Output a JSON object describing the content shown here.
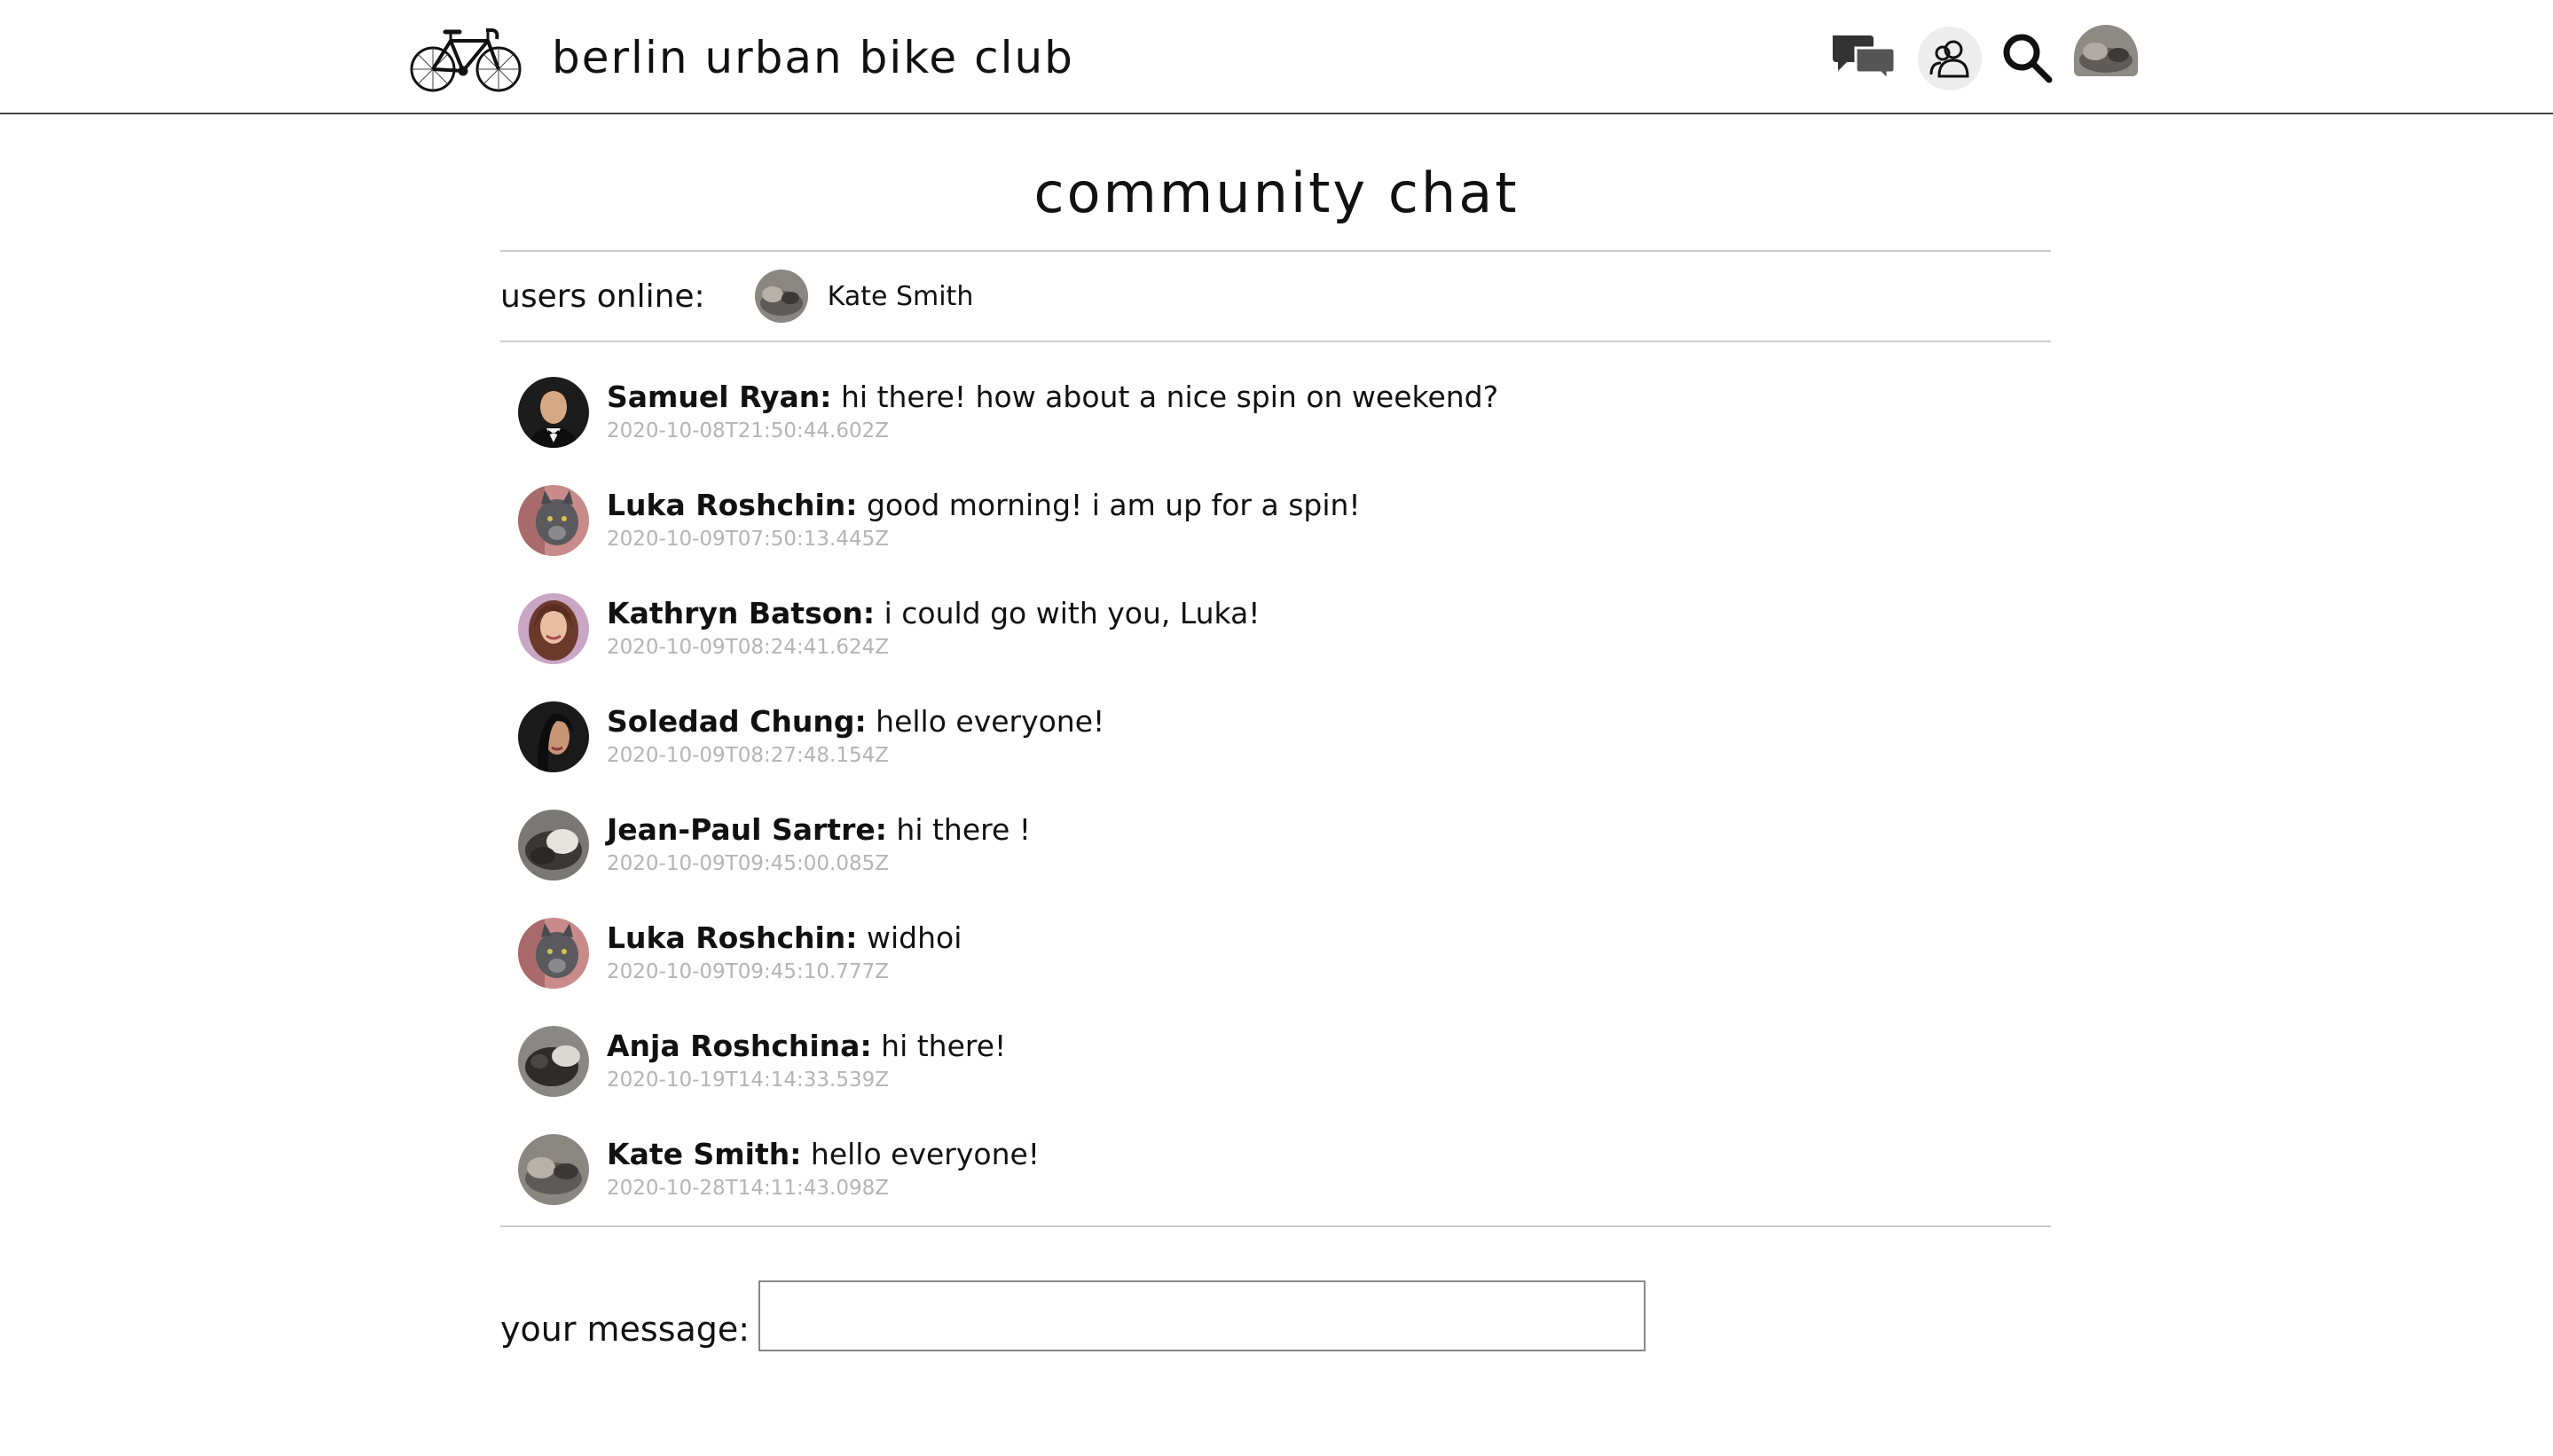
{
  "app": {
    "name": "berlin urban bike club"
  },
  "header": {
    "icons": {
      "chat": "chat-bubbles-icon",
      "friends": "friends-icon",
      "search": "search-icon",
      "profile": "profile-avatar"
    }
  },
  "page": {
    "title": "community chat"
  },
  "online": {
    "label": "users online:",
    "users": [
      {
        "name": "Kate Smith"
      }
    ]
  },
  "messages": [
    {
      "author": "Samuel Ryan:",
      "text": "hi there! how about a nice spin on weekend?",
      "time": "2020-10-08T21:50:44.602Z"
    },
    {
      "author": "Luka Roshchin:",
      "text": "good morning! i am up for a spin!",
      "time": "2020-10-09T07:50:13.445Z"
    },
    {
      "author": "Kathryn Batson:",
      "text": "i could go with you, Luka!",
      "time": "2020-10-09T08:24:41.624Z"
    },
    {
      "author": "Soledad Chung:",
      "text": "hello everyone!",
      "time": "2020-10-09T08:27:48.154Z"
    },
    {
      "author": "Jean-Paul Sartre:",
      "text": "hi there !",
      "time": "2020-10-09T09:45:00.085Z"
    },
    {
      "author": "Luka Roshchin:",
      "text": "widhoi",
      "time": "2020-10-09T09:45:10.777Z"
    },
    {
      "author": "Anja Roshchina:",
      "text": "hi there!",
      "time": "2020-10-19T14:14:33.539Z"
    },
    {
      "author": "Kate Smith:",
      "text": "hello everyone!",
      "time": "2020-10-28T14:11:43.098Z"
    }
  ],
  "composer": {
    "label": "your message:",
    "value": ""
  }
}
